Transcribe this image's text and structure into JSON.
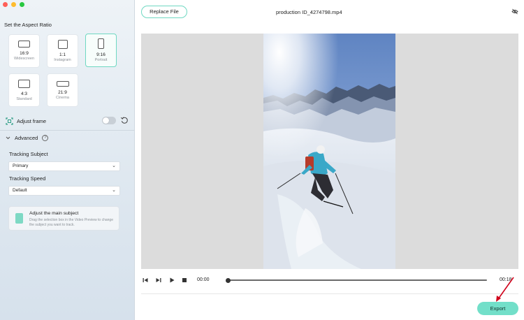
{
  "window": {
    "controls": [
      "close",
      "minimize",
      "zoom"
    ]
  },
  "sidebar": {
    "aspect_title": "Set the Aspect Ratio",
    "ratios": [
      {
        "title": "16:9",
        "sub": "Widescreen",
        "selected": false
      },
      {
        "title": "1:1",
        "sub": "Instagram",
        "selected": false
      },
      {
        "title": "9:16",
        "sub": "Portrait",
        "selected": true
      },
      {
        "title": "4:3",
        "sub": "Standard",
        "selected": false
      },
      {
        "title": "21:9",
        "sub": "Cinema",
        "selected": false
      }
    ],
    "adjust_frame_label": "Adjust frame",
    "adjust_frame_on": false,
    "advanced_label": "Advanced",
    "advanced_help": "?",
    "tracking_subject_label": "Tracking Subject",
    "tracking_subject_value": "Primary",
    "tracking_speed_label": "Tracking Speed",
    "tracking_speed_value": "Default",
    "info_title": "Adjust the main subject",
    "info_body": "Drag the selection box in the Video Preview to change the subject you want to track."
  },
  "header": {
    "replace_label": "Replace File",
    "file_name": "production ID_4274798.mp4"
  },
  "player": {
    "current_time": "00:00",
    "end_time": "00:18",
    "progress": 0.01
  },
  "footer": {
    "export_label": "Export"
  },
  "colors": {
    "accent": "#72dfc9",
    "selected_border": "#6fd8c2",
    "annotation_arrow": "#d0021b"
  }
}
